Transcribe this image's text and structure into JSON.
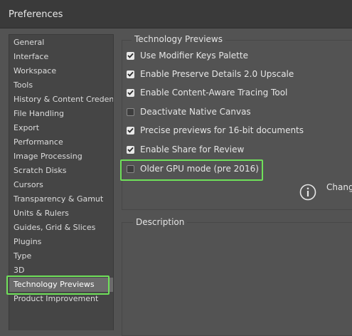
{
  "window": {
    "title": "Preferences"
  },
  "sidebar": {
    "items": [
      {
        "label": "General"
      },
      {
        "label": "Interface"
      },
      {
        "label": "Workspace"
      },
      {
        "label": "Tools"
      },
      {
        "label": "History & Content Creden..."
      },
      {
        "label": "File Handling"
      },
      {
        "label": "Export"
      },
      {
        "label": "Performance"
      },
      {
        "label": "Image Processing"
      },
      {
        "label": "Scratch Disks"
      },
      {
        "label": "Cursors"
      },
      {
        "label": "Transparency & Gamut"
      },
      {
        "label": "Units & Rulers"
      },
      {
        "label": "Guides, Grid & Slices"
      },
      {
        "label": "Plugins"
      },
      {
        "label": "Type"
      },
      {
        "label": "3D"
      },
      {
        "label": "Technology Previews",
        "selected": true
      },
      {
        "label": "Product Improvement"
      }
    ]
  },
  "technology_previews": {
    "title": "Technology Previews",
    "options": [
      {
        "label": "Use Modifier Keys Palette",
        "checked": true
      },
      {
        "label": "Enable Preserve Details 2.0 Upscale",
        "checked": true
      },
      {
        "label": "Enable Content-Aware Tracing Tool",
        "checked": true
      },
      {
        "label": "Deactivate Native Canvas",
        "checked": false
      },
      {
        "label": "Precise previews for 16-bit documents",
        "checked": true
      },
      {
        "label": "Enable Share for Review",
        "checked": true
      },
      {
        "label": "Older GPU mode (pre 2016)",
        "checked": false
      }
    ],
    "info_text": "Chang"
  },
  "description": {
    "title": "Description"
  },
  "colors": {
    "highlight": "#6fe05a",
    "selected_bg": "#6b6b6b"
  }
}
